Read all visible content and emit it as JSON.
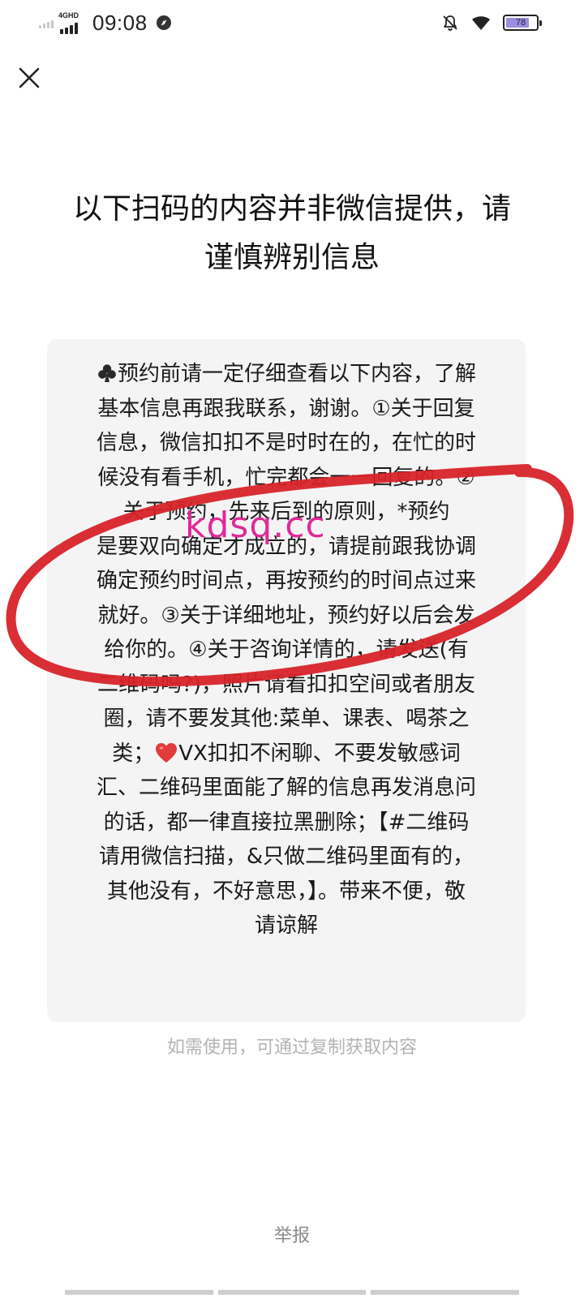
{
  "status_bar": {
    "network_label": "4GHD",
    "time": "09:08",
    "battery_level": "78",
    "battery_fraction": 0.78
  },
  "title": {
    "line1": "以下扫码的内容并非微信提供，请",
    "line2": "谨慎辨别信息"
  },
  "content": {
    "lines": [
      "预约前请一定仔细查看以下内容，了解",
      "基本信息再跟我联系，谢谢。①关于回复",
      "信息，微信扣扣不是时时在的，在忙的时",
      "候没有看手机，忙完都会一一回复的。②",
      "关于预约，先来后到的原则，*预约",
      "是要双向确定才成立的，请提前跟我协调",
      "确定预约时间点，再按预约的时间点过来",
      "就好。③关于详细地址，预约好以后会发",
      "给你的。④关于咨询详情的，请发送(有",
      "二维码吗?)，照片请看扣扣空间或者朋友",
      "圈，请不要发其他:菜单、课表、喝茶之",
      "类；",
      "汇、二维码里面能了解的信息再发消息问",
      "的话，都一律直接拉黑删除；【#二维码",
      "请用微信扫描，&只做二维码里面有的，",
      "其他没有，不好意思，】。带来不便，敬",
      "请谅解"
    ],
    "line12_rest": "VX扣扣不闲聊、不要发敏感词"
  },
  "watermark": "kdsq.cc",
  "copy_hint": "如需使用，可通过复制获取内容",
  "report_label": "举报",
  "colors": {
    "background": "#ffffff",
    "content_box": "#f4f4f4",
    "hint": "#b4b4b4",
    "report": "#8a8a8a",
    "watermark": "#e0299a",
    "annotation": "#d8232a",
    "heart": "#e23b3b",
    "battery_fill": "#9b8de0"
  },
  "icons": {
    "close": "close-icon",
    "club": "club-icon",
    "heart": "heart-icon",
    "wifi": "wifi-icon",
    "bell_off": "bell-off-icon",
    "compass": "compass-icon"
  }
}
